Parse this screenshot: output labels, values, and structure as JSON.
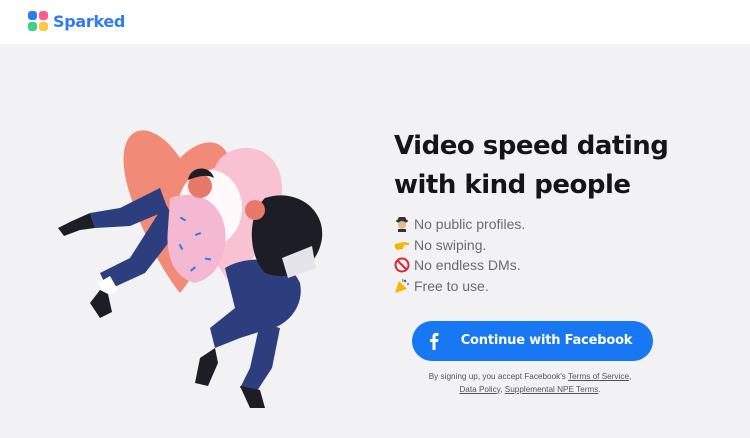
{
  "brand": {
    "name": "Sparked",
    "color": "#2d7cf3",
    "logo_colors": [
      "#2d7cf3",
      "#ff5d8f",
      "#3ccf8e",
      "#ffc93c"
    ]
  },
  "hero": {
    "title_line1": "Video speed dating",
    "title_line2": "with kind people"
  },
  "features": [
    {
      "icon": "spy-icon",
      "text": "No public profiles."
    },
    {
      "icon": "pointing-hand-icon",
      "text": "No swiping."
    },
    {
      "icon": "prohibited-icon",
      "text": "No endless DMs."
    },
    {
      "icon": "party-popper-icon",
      "text": "Free to use."
    }
  ],
  "cta": {
    "label": "Continue with Facebook",
    "color": "#1877f2"
  },
  "disclaimer": {
    "prefix": "By signing up, you accept Facebook's ",
    "terms_link": "Terms of Service",
    "comma": ",",
    "data_policy_link": "Data Policy",
    "sep": ", ",
    "npe_link": "Supplemental NPE Terms",
    "suffix": "."
  }
}
